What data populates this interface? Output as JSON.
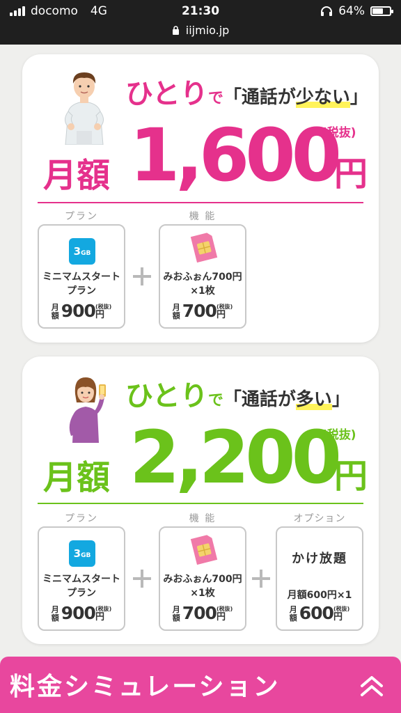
{
  "status_bar": {
    "carrier": "docomo",
    "network": "4G",
    "time": "21:30",
    "battery": "64%",
    "battery_level": 0.64,
    "url": "iijmio.jp"
  },
  "colors": {
    "pink": "#e5318c",
    "green": "#6bc21b",
    "bar_pink": "#e8479e",
    "sky": "#13a8e0"
  },
  "plans": [
    {
      "headline_hitori": "ひとり",
      "headline_de": "で",
      "headline_open": "「通話が",
      "headline_mark": "少ない",
      "headline_close": "」",
      "monthly_label": "月額",
      "price": "1,600",
      "yen": "円",
      "tax": "(税抜)",
      "items": [
        {
          "col_label": "プラン",
          "icon": "3gb-icon",
          "icon_text": "3",
          "icon_unit": "GB",
          "name_line1": "ミニマムスタート",
          "name_line2": "プラン",
          "getsu": "月額",
          "price": "900",
          "yen": "円",
          "tax": "(税抜)"
        },
        {
          "col_label": "機 能",
          "icon": "sim-card-icon",
          "name_line1": "みおふぉん700円",
          "name_line2": "×1枚",
          "getsu": "月額",
          "price": "700",
          "yen": "円",
          "tax": "(税抜)"
        }
      ]
    },
    {
      "headline_hitori": "ひとり",
      "headline_de": "で",
      "headline_open": "「通話が",
      "headline_mark": "多い",
      "headline_close": "」",
      "monthly_label": "月額",
      "price": "2,200",
      "yen": "円",
      "tax": "(税抜)",
      "items": [
        {
          "col_label": "プラン",
          "icon": "3gb-icon",
          "icon_text": "3",
          "icon_unit": "GB",
          "name_line1": "ミニマムスタート",
          "name_line2": "プラン",
          "getsu": "月額",
          "price": "900",
          "yen": "円",
          "tax": "(税抜)"
        },
        {
          "col_label": "機 能",
          "icon": "sim-card-icon",
          "name_line1": "みおふぉん700円",
          "name_line2": "×1枚",
          "getsu": "月額",
          "price": "700",
          "yen": "円",
          "tax": "(税抜)"
        },
        {
          "col_label": "オプション",
          "title": "かけ放題",
          "sub": "月額600円×1",
          "getsu": "月額",
          "price": "600",
          "yen": "円",
          "tax": "(税抜)"
        }
      ]
    }
  ],
  "simulation_bar": {
    "label": "料金シミュレーション",
    "icon": "double-chevron-up-icon"
  }
}
